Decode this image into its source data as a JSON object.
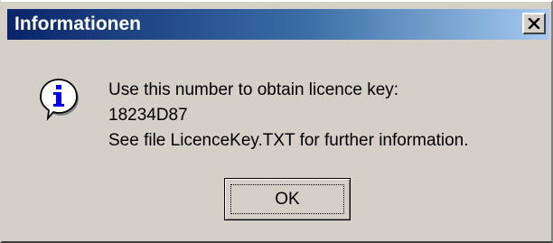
{
  "window": {
    "title": "Informationen",
    "close_glyph": "×"
  },
  "message": {
    "line1": "Use this number to obtain licence key:",
    "line2": "18234D87",
    "line3": "See file LicenceKey.TXT for further information."
  },
  "buttons": {
    "ok_label": "OK"
  },
  "icons": {
    "info": "info-icon",
    "close": "close-icon"
  },
  "colors": {
    "title_gradient_start": "#0a246a",
    "title_gradient_end": "#a6caf0",
    "dialog_face": "#d4d0c8",
    "info_icon_blue": "#0000ff"
  }
}
